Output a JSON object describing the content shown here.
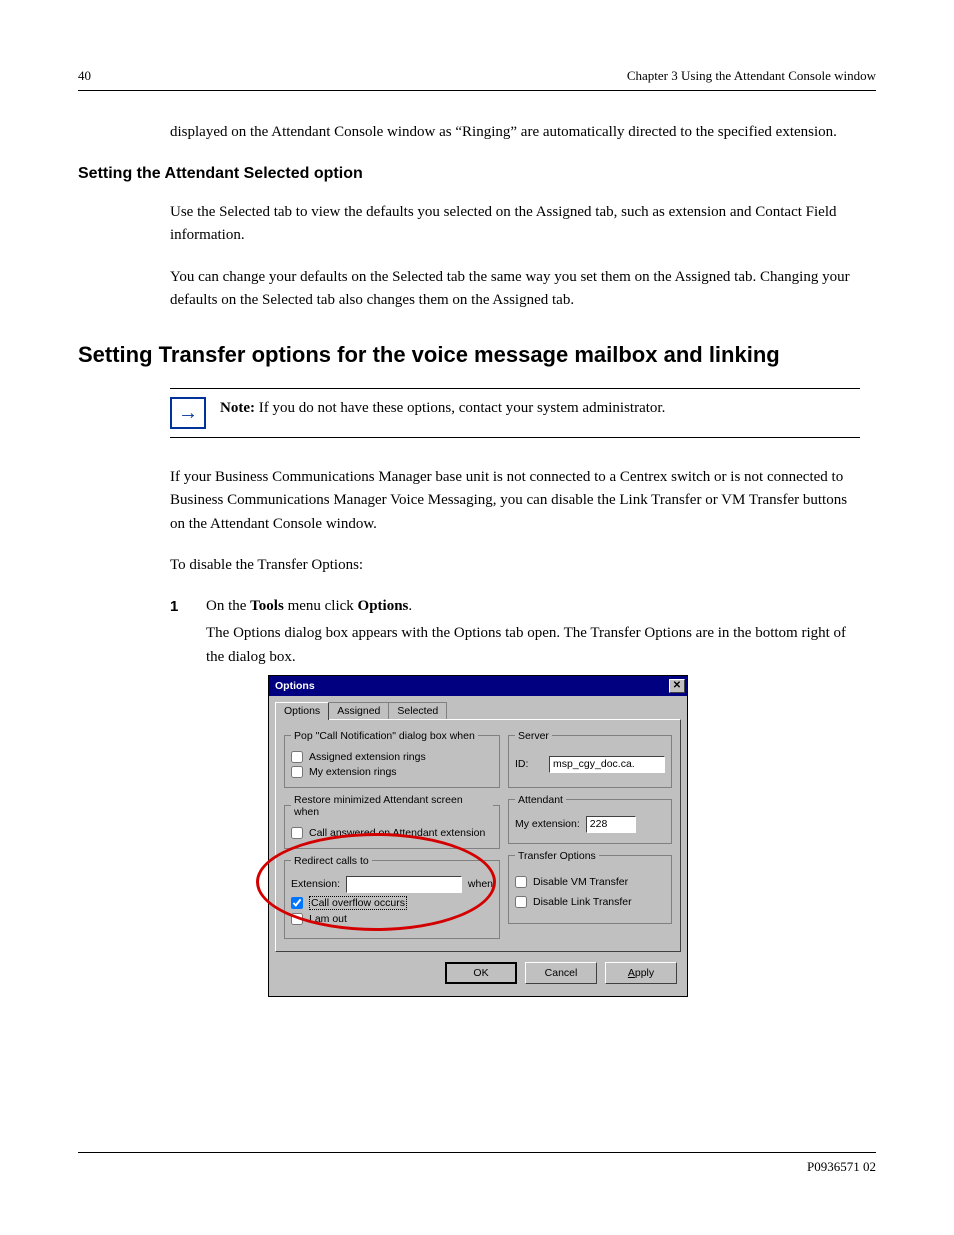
{
  "header": {
    "pageNumber": "40",
    "chapter": "Chapter 3  Using the Attendant Console window"
  },
  "para1": "displayed on the Attendant Console window as “Ringing” are automatically directed to the specified extension.",
  "section_title": "Setting the Attendant Selected option",
  "para2": "Use the Selected tab to view the defaults you selected on the Assigned tab, such as extension and Contact Field information.",
  "para3": "You can change your defaults on the Selected tab the same way you set them on the Assigned tab. Changing your defaults on the Selected tab also changes them on the Assigned tab.",
  "h2": "Setting Transfer options for the voice message mailbox and linking",
  "note": {
    "label": "Note:",
    "text": "If you do not have these options, contact your system administrator."
  },
  "para4": "If your Business Communications Manager base unit is not connected to a Centrex switch or is not connected to Business Communications Manager Voice Messaging, you can disable the Link Transfer or VM Transfer buttons on the Attendant Console window.",
  "para5": "To disable the Transfer Options:",
  "steps": [
    {
      "num": "1",
      "text": "On the Tools menu click Options.",
      "sub": "The Options dialog box appears with the Options tab open. The Transfer Options are in the bottom right of the dialog box."
    }
  ],
  "dialog": {
    "title": "Options",
    "tabs": {
      "options": "Options",
      "assigned": "Assigned",
      "selected": "Selected"
    },
    "group_pop_legend": "Pop \"Call Notification\" dialog box when",
    "chk_assigned_rings": "Assigned extension rings",
    "chk_my_rings": "My extension rings",
    "group_restore_legend": "Restore minimized Attendant screen when",
    "chk_call_answered": "Call answered on Attendant extension",
    "group_redirect_legend": "Redirect calls to",
    "redirect_extension_label": "Extension:",
    "redirect_when_label": "when",
    "chk_call_overflow": "Call overflow occurs",
    "chk_i_am_out": "I am out",
    "group_server_legend": "Server",
    "server_id_label": "ID:",
    "server_id_value": "msp_cgy_doc.ca.",
    "group_attendant_legend": "Attendant",
    "attendant_ext_label": "My extension:",
    "attendant_ext_value": "228",
    "group_transfer_legend": "Transfer Options",
    "chk_disable_vm": "Disable VM Transfer",
    "chk_disable_link": "Disable Link Transfer",
    "btn_ok": "OK",
    "btn_cancel": "Cancel",
    "btn_apply": "Apply"
  },
  "footer": {
    "doc": "P0936571 02"
  }
}
